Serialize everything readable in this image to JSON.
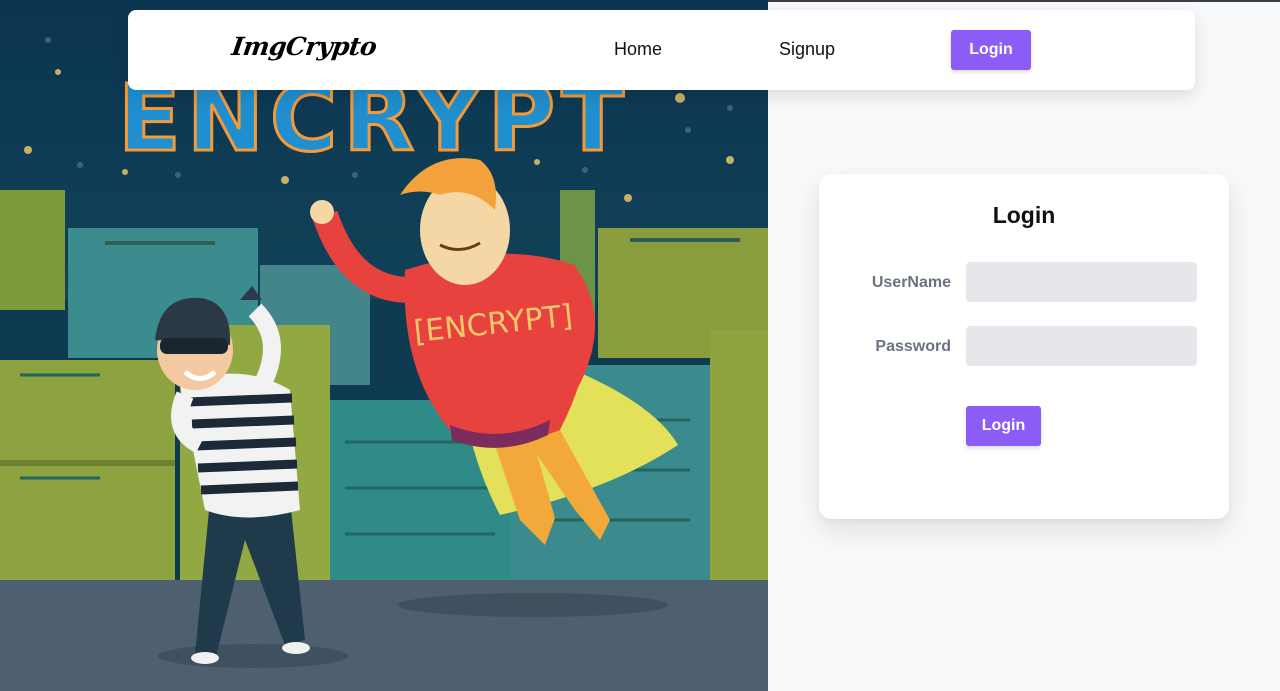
{
  "navbar": {
    "brand": "ImgCrypto",
    "links": [
      "Home",
      "Signup"
    ],
    "login_button": "Login"
  },
  "login_form": {
    "title": "Login",
    "username_label": "UserName",
    "username_value": "",
    "password_label": "Password",
    "password_value": "",
    "submit_label": "Login"
  },
  "hero": {
    "sign_text": "ENCRYPT",
    "shirt_text": "[ENCRYPT]"
  },
  "colors": {
    "accent": "#8b5cf6",
    "input_bg": "#e5e7eb",
    "label": "#6b7280",
    "page_bg": "#f8f9fb"
  }
}
